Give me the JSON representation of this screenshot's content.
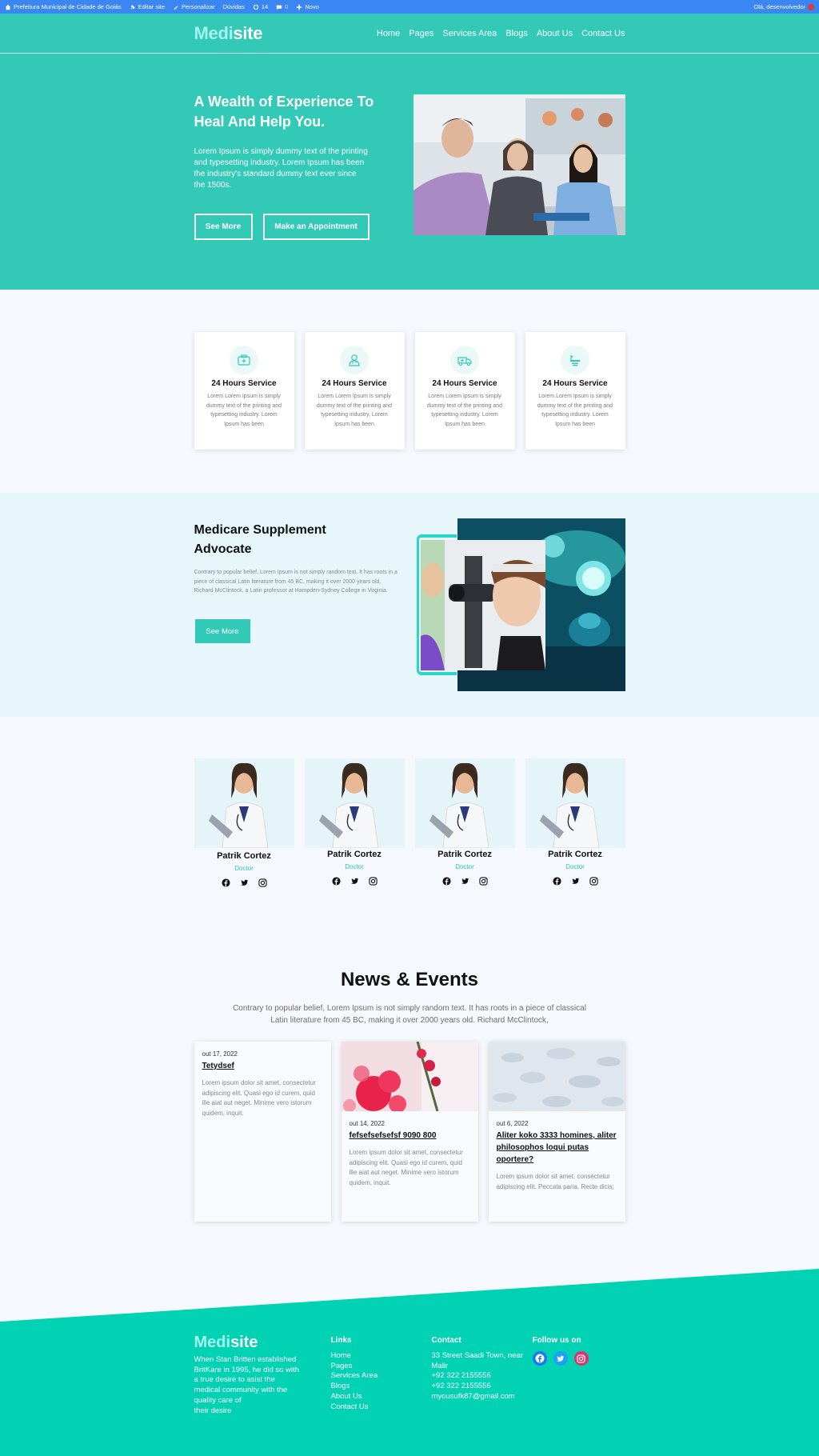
{
  "admin_bar": {
    "site_name": "Prefeitura Municipal de Cidade de Goiás",
    "edit_site": "Editar site",
    "customize": "Personalizar",
    "doubts": "Dúvidas",
    "updates_count": "14",
    "comments_count": "0",
    "new": "Novo",
    "greeting": "Olá, desenvolvedor"
  },
  "header": {
    "logo_part1": "Medi",
    "logo_part2": "site",
    "nav": [
      "Home",
      "Pages",
      "Services Area",
      "Blogs",
      "About Us",
      "Contact Us"
    ]
  },
  "hero": {
    "title": "A Wealth of Experience To Heal And Help You.",
    "text_lines": [
      "Lorem Ipsum is simply dummy text of the printing and typesetting industry. Lorem Ipsum has been the industry's standard dummy text ever since",
      "the 1500s."
    ],
    "btn_primary": "See More",
    "btn_secondary": "Make an Appointment"
  },
  "services": {
    "items": [
      {
        "icon": "medical-kit-icon",
        "title": "24 Hours Service",
        "text": "Lorem Lorem Ipsum is simply dummy text of the printing and typesetting industry. Lorem Ipsum has been"
      },
      {
        "icon": "doctor-icon",
        "title": "24 Hours Service",
        "text": "Lorem Lorem Ipsum is simply dummy text of the printing and typesetting industry. Lorem Ipsum has been"
      },
      {
        "icon": "ambulance-icon",
        "title": "24 Hours Service",
        "text": "Lorem Lorem Ipsum is simply dummy text of the printing and typesetting industry. Lorem Ipsum has been"
      },
      {
        "icon": "hospital-bed-icon",
        "title": "24 Hours Service",
        "text": "Lorem Lorem Ipsum is simply dummy text of the printing and typesetting industry. Lorem Ipsum has been"
      }
    ]
  },
  "medicare": {
    "title": "Medicare Supplement Advocate",
    "text": "Contrary to popular belief, Lorem Ipsum is not simply random text. It has roots in a piece of classical Latin literature from 45 BC, making it over 2000 years old. Richard McClintock, a Latin professor at Hampden-Sydney College in Virginia.",
    "button": "See More"
  },
  "doctors": {
    "items": [
      {
        "name": "Patrik Cortez",
        "role": "Doctor"
      },
      {
        "name": "Patrik Cortez",
        "role": "Doctor"
      },
      {
        "name": "Patrik Cortez",
        "role": "Doctor"
      },
      {
        "name": "Patrik Cortez",
        "role": "Doctor"
      }
    ]
  },
  "news": {
    "title": "News & Events",
    "intro": "Contrary to popular belief, Lorem Ipsum is not simply random text. It has roots in a piece of classical Latin literature from 45 BC, making it over 2000 years old. Richard McClintock,",
    "items": [
      {
        "date": "out 17, 2022",
        "headline": "Tetydsef",
        "excerpt": "Lorem ipsum dolor sit amet, consectetur adipiscing elit. Quasi ego id curem, quid ille aiat aut neget. Minime vero istorum quidem, inquit."
      },
      {
        "date": "out 14, 2022",
        "headline": "fefsefsefsefsf 9090 800",
        "excerpt": "Lorem ipsum dolor sit amet, consectetur adipiscing elit. Quasi ego id curem, quid ille aiat aut neget. Minime vero istorum quidem, inquit."
      },
      {
        "date": "out 6, 2022",
        "headline": "Aliter koko 3333 homines, aliter philosophos loqui putas oportere?",
        "excerpt": "Lorem ipsum dolor sit amet, consectetur adipiscing elit. Peccata paria. Recte dicis;"
      }
    ]
  },
  "footer": {
    "logo_part1": "Medi",
    "logo_part2": "site",
    "about_lines": [
      "When Stan Britten established BritKare in 1995, he did so with a true desire to asist the medical community with the quality care of",
      "their desire"
    ],
    "links_heading": "Links",
    "links": [
      "Home",
      "Pages",
      "Services Area",
      "Blogs",
      "About Us",
      "Contact Us"
    ],
    "contact_heading": "Contact",
    "contact": [
      "33 Street Saadi Town, near Malir",
      "+92 322 2155556",
      "+92 322 2155556",
      "myousufk87@gmail.com"
    ],
    "follow_heading": "Follow us on",
    "social": [
      {
        "icon": "facebook-icon",
        "color": "#1877f2"
      },
      {
        "icon": "twitter-icon",
        "color": "#1da1f2"
      },
      {
        "icon": "instagram-icon",
        "color": "#e1306c"
      }
    ]
  },
  "colors": {
    "brand": "#32c9b6",
    "footer_bg": "#00d2b3",
    "admin_bar": "#3a86f2"
  }
}
